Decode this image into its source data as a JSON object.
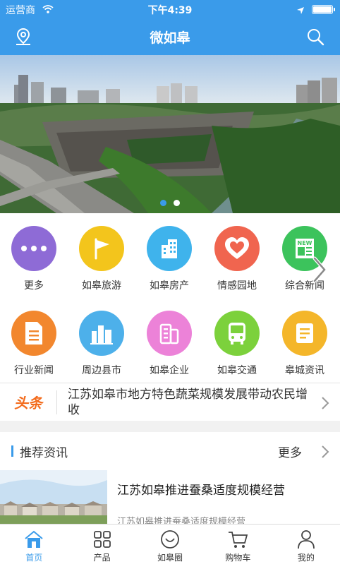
{
  "status_bar": {
    "carrier": "运营商",
    "time": "下午4:39"
  },
  "nav": {
    "title": "微如皋"
  },
  "banner": {
    "slides": 2,
    "active": 0
  },
  "grid": [
    {
      "label": "更多",
      "icon": "more-icon",
      "color": "#8e6bd6"
    },
    {
      "label": "如皋旅游",
      "icon": "flag-icon",
      "color": "#f3c51c"
    },
    {
      "label": "如皋房产",
      "icon": "building-icon",
      "color": "#3fb3ec"
    },
    {
      "label": "情感园地",
      "icon": "heart-icon",
      "color": "#f0654f"
    },
    {
      "label": "综合新闻",
      "icon": "newspaper-icon",
      "color": "#3cc35c"
    },
    {
      "label": "行业新闻",
      "icon": "document-icon",
      "color": "#f2872e"
    },
    {
      "label": "周边县市",
      "icon": "city-icon",
      "color": "#4db0ea"
    },
    {
      "label": "如皋企业",
      "icon": "company-icon",
      "color": "#ec82d8"
    },
    {
      "label": "如皋交通",
      "icon": "bus-icon",
      "color": "#7cd13c"
    },
    {
      "label": "皋城资讯",
      "icon": "info-icon",
      "color": "#f4b62a"
    }
  ],
  "headline": {
    "tag": "头条",
    "text": "江苏如皋市地方特色蔬菜规模发展带动农民增收"
  },
  "section": {
    "title": "推荐资讯",
    "more": "更多"
  },
  "news": [
    {
      "title": "江苏如皋推进蚕桑适度规模经营",
      "summary": "江苏如皋推进蚕桑适度规模经营"
    }
  ],
  "tabs": [
    {
      "label": "首页",
      "icon": "home-icon",
      "active": true
    },
    {
      "label": "产品",
      "icon": "grid-icon",
      "active": false
    },
    {
      "label": "如皋圈",
      "icon": "smile-icon",
      "active": false
    },
    {
      "label": "购物车",
      "icon": "cart-icon",
      "active": false
    },
    {
      "label": "我的",
      "icon": "user-icon",
      "active": false
    }
  ],
  "colors": {
    "primary": "#3a9bea",
    "headline_tag": "#f36b1c"
  }
}
